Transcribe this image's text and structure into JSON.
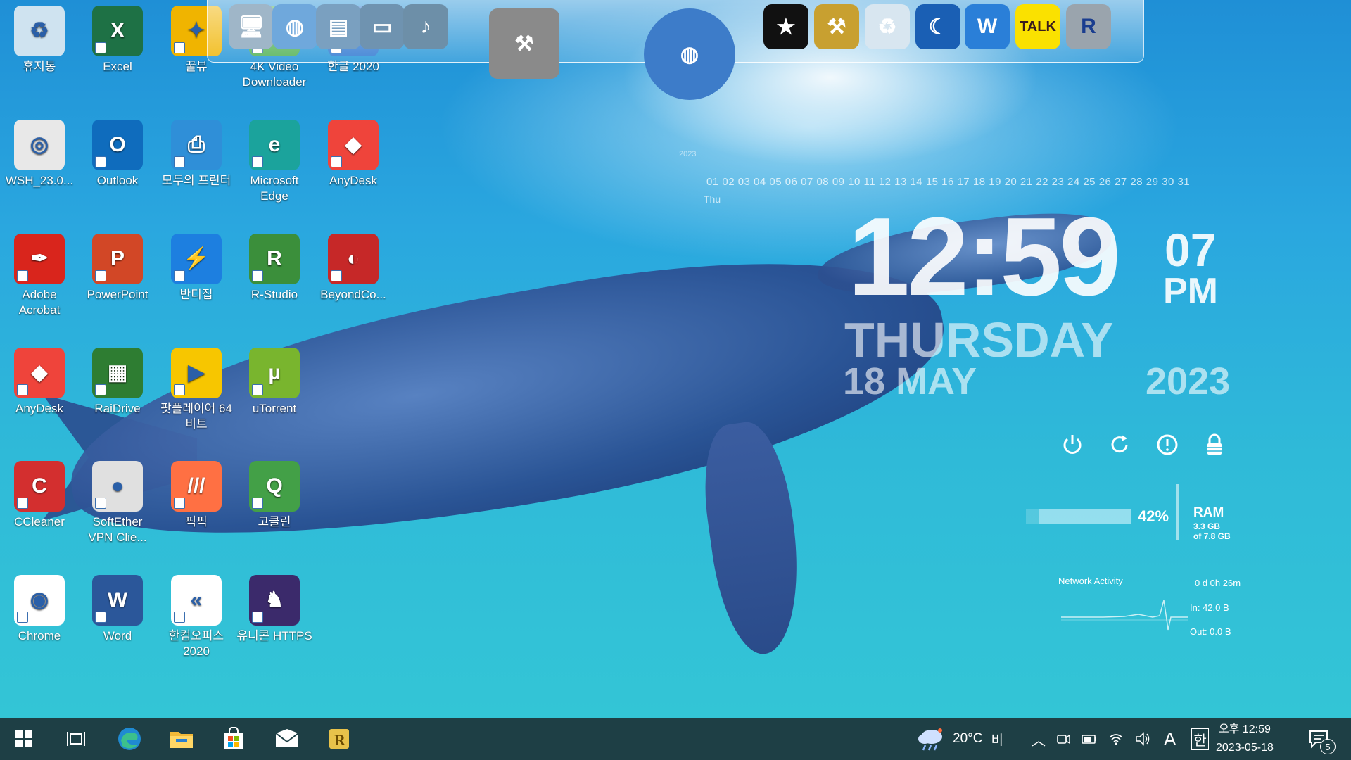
{
  "desktop_icons": [
    {
      "id": "recycle-bin",
      "label": "휴지통",
      "icon": "recycle-bin-icon",
      "color": "#cfe3f0"
    },
    {
      "id": "excel",
      "label": "Excel",
      "icon": "excel-icon",
      "color": "#1e7145"
    },
    {
      "id": "kkulbyu",
      "label": "꿀뷰",
      "icon": "kkulbyu-icon",
      "color": "#f0b400"
    },
    {
      "id": "4k-video-downloader",
      "label": "4K Video Downloader",
      "icon": "4k-video-downloader-icon",
      "color": "#4caf50"
    },
    {
      "id": "hangul-2020",
      "label": "한글 2020",
      "icon": "hangul-icon",
      "color": "#2a75d0"
    },
    {
      "id": "wsh",
      "label": "WSH_23.0...",
      "icon": "disc-icon",
      "color": "#e8e8e8"
    },
    {
      "id": "outlook",
      "label": "Outlook",
      "icon": "outlook-icon",
      "color": "#0f6cbd"
    },
    {
      "id": "modu-printer",
      "label": "모두의 프린터",
      "icon": "printer-icon",
      "color": "#2f8fd8"
    },
    {
      "id": "edge",
      "label": "Microsoft Edge",
      "icon": "edge-icon",
      "color": "#1ba39c"
    },
    {
      "id": "anydesk-1",
      "label": "AnyDesk",
      "icon": "anydesk-icon",
      "color": "#ef443b"
    },
    {
      "id": "acrobat",
      "label": "Adobe Acrobat",
      "icon": "acrobat-icon",
      "color": "#d9251c"
    },
    {
      "id": "powerpoint",
      "label": "PowerPoint",
      "icon": "powerpoint-icon",
      "color": "#d24726"
    },
    {
      "id": "bandizip",
      "label": "반디집",
      "icon": "bandizip-icon",
      "color": "#1d7fe0"
    },
    {
      "id": "r-studio",
      "label": "R-Studio",
      "icon": "r-studio-icon",
      "color": "#3b8f3b"
    },
    {
      "id": "beyond-compare",
      "label": "BeyondCo...",
      "icon": "beyond-compare-icon",
      "color": "#c62828"
    },
    {
      "id": "anydesk-2",
      "label": "AnyDesk",
      "icon": "anydesk-icon",
      "color": "#ef443b"
    },
    {
      "id": "raidrive",
      "label": "RaiDrive",
      "icon": "raidrive-icon",
      "color": "#2e7d32"
    },
    {
      "id": "potplayer",
      "label": "팟플레이어 64 비트",
      "icon": "potplayer-icon",
      "color": "#f7c600"
    },
    {
      "id": "utorrent",
      "label": "uTorrent",
      "icon": "utorrent-icon",
      "color": "#79b52e"
    },
    {
      "id": "ccleaner",
      "label": "CCleaner",
      "icon": "ccleaner-icon",
      "color": "#d32f2f"
    },
    {
      "id": "softether",
      "label": "SoftEther VPN Clie...",
      "icon": "softether-icon",
      "color": "#e0e0e0"
    },
    {
      "id": "picpick",
      "label": "픽픽",
      "icon": "picpick-icon",
      "color": "#ff7043"
    },
    {
      "id": "gocleaner",
      "label": "고클린",
      "icon": "gocleaner-icon",
      "color": "#43a047"
    },
    {
      "id": "chrome",
      "label": "Chrome",
      "icon": "chrome-icon",
      "color": "#ffffff"
    },
    {
      "id": "word",
      "label": "Word",
      "icon": "word-icon",
      "color": "#2b579a"
    },
    {
      "id": "hancom-office",
      "label": "한컴오피스 2020",
      "icon": "hancom-office-icon",
      "color": "#ffffff"
    },
    {
      "id": "unicorn-https",
      "label": "유니콘 HTTPS",
      "icon": "unicorn-https-icon",
      "color": "#3b2a6b"
    }
  ],
  "dock": {
    "items": [
      {
        "id": "dock-computer",
        "icon": "computer-icon",
        "color": "#9fb6c8"
      },
      {
        "id": "dock-network",
        "icon": "network-icon",
        "color": "#6fa8dc"
      },
      {
        "id": "dock-documents",
        "icon": "documents-folder-icon",
        "color": "#7aa0c0"
      },
      {
        "id": "dock-folder",
        "icon": "folder-icon",
        "color": "#6f93b0"
      },
      {
        "id": "dock-music-folder",
        "icon": "music-folder-icon",
        "color": "#6d8fa8"
      },
      {
        "id": "dock-tools",
        "icon": "tools-icon",
        "color": "#8a8a8a"
      },
      {
        "id": "dock-globe",
        "icon": "globe-icon",
        "color": "#3d7cc9"
      },
      {
        "id": "dock-tshirt",
        "icon": "tshirt-icon",
        "color": "#111111"
      },
      {
        "id": "dock-hammer",
        "icon": "hammer-icon",
        "color": "#c8a030"
      },
      {
        "id": "dock-recycle",
        "icon": "recycle-bin-icon",
        "color": "#d8e6f0"
      },
      {
        "id": "dock-moon",
        "icon": "moon-icon",
        "color": "#1a5fb4"
      },
      {
        "id": "dock-shield",
        "icon": "shield-icon",
        "color": "#2a7fd8"
      },
      {
        "id": "dock-kakaotalk",
        "icon": "kakaotalk-icon",
        "color": "#fae100",
        "label": "TALK"
      },
      {
        "id": "dock-r-app",
        "icon": "r-app-icon",
        "color": "#9aa4ad",
        "label": "R"
      }
    ]
  },
  "calendar": {
    "days": "01 02 03 04 05 06 07 08 09 10 11 12 13 14 15 16 17 18 19 20 21 22 23 24 25 26 27 28 29 30 31",
    "day_abbrev": "Thu"
  },
  "clock": {
    "time": "12:59",
    "seconds": "07",
    "ampm": "PM",
    "weekday": "THURSDAY",
    "date": "18 MAY",
    "year": "2023"
  },
  "power_icons": [
    "power-icon",
    "restart-icon",
    "logoff-icon",
    "lock-icon"
  ],
  "ram": {
    "percent": "42%",
    "fraction": 0.42,
    "label": "RAM",
    "used": "3.3 GB",
    "total": "of 7.8 GB"
  },
  "network": {
    "label": "Network Activity",
    "uptime": "0 d 0h 26m",
    "in": "In: 42.0 B",
    "out": "Out: 0.0 B"
  },
  "taskbar": {
    "items": [
      {
        "id": "start",
        "icon": "windows-start-icon"
      },
      {
        "id": "task-view",
        "icon": "task-view-icon"
      },
      {
        "id": "edge",
        "icon": "edge-icon"
      },
      {
        "id": "file-explorer",
        "icon": "file-explorer-icon"
      },
      {
        "id": "store",
        "icon": "store-icon"
      },
      {
        "id": "mail",
        "icon": "mail-icon"
      },
      {
        "id": "r-app",
        "icon": "r-app-icon"
      }
    ],
    "weather": {
      "temp": "20°C",
      "condition": "비"
    },
    "ime_lang": "A",
    "ime_mode": "한",
    "time": "오후 12:59",
    "date": "2023-05-18",
    "notification_count": "5"
  }
}
